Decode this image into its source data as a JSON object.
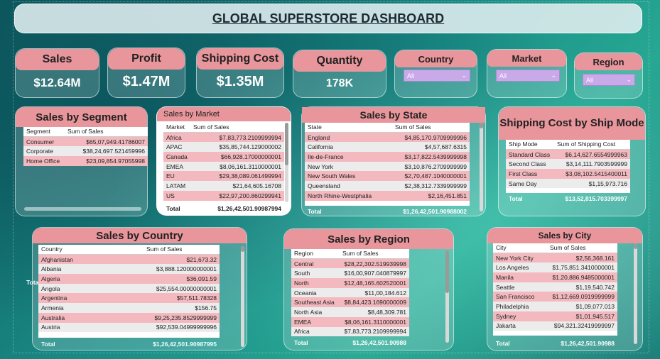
{
  "header": {
    "title": "GLOBAL SUPERSTORE DASHBOARD"
  },
  "kpis": {
    "sales": {
      "label": "Sales",
      "value": "$12.64M"
    },
    "profit": {
      "label": "Profit",
      "value": "$1.47M"
    },
    "shipping": {
      "label": "Shipping Cost",
      "value": "$1.35M"
    },
    "quantity": {
      "label": "Quantity",
      "value": "178K"
    }
  },
  "slicers": {
    "country": {
      "label": "Country",
      "value": "All"
    },
    "market": {
      "label": "Market",
      "value": "All"
    },
    "region": {
      "label": "Region",
      "value": "All"
    }
  },
  "segment": {
    "title": "Sales by Segment",
    "columns": [
      "Segment",
      "Sum of Sales"
    ],
    "rows": [
      [
        "Consumer",
        "$65,07,949.41786007"
      ],
      [
        "Corporate",
        "$38,24,697.521459996"
      ],
      [
        "Home Office",
        "$23,09,854.97055998"
      ]
    ],
    "total": [
      "Total",
      "$1,26,42,501.90988005"
    ]
  },
  "market": {
    "title": "Sales by Market",
    "columns": [
      "Market",
      "Sum of Sales"
    ],
    "rows": [
      [
        "Africa",
        "$7,83,773.2109999994"
      ],
      [
        "APAC",
        "$35,85,744.129000002"
      ],
      [
        "Canada",
        "$66,928.17000000001"
      ],
      [
        "EMEA",
        "$8,06,161.3110000001"
      ],
      [
        "EU",
        "$29,38,089.061499994"
      ],
      [
        "LATAM",
        "$21,64,605.16708"
      ],
      [
        "US",
        "$22,97,200.860299941"
      ]
    ],
    "total": [
      "Total",
      "$1,26,42,501.90987994"
    ]
  },
  "state": {
    "title": "Sales by State",
    "columns": [
      "State",
      "Sum of Sales"
    ],
    "rows": [
      [
        "England",
        "$4,85,170.9709999996"
      ],
      [
        "California",
        "$4,57,687.6315"
      ],
      [
        "Ile-de-France",
        "$3,17,822.5439999998"
      ],
      [
        "New York",
        "$3,10,876.2709999999"
      ],
      [
        "New South Wales",
        "$2,70,487.1040000001"
      ],
      [
        "Queensland",
        "$2,38,312.7339999999"
      ],
      [
        "North Rhine-Westphalia",
        "$2,16,451.851"
      ]
    ],
    "total": [
      "Total",
      "$1,26,42,501.90988002"
    ]
  },
  "shipmode": {
    "title": "Shipping Cost by Ship Mode",
    "columns": [
      "Ship Mode",
      "Sum of Shipping Cost"
    ],
    "rows": [
      [
        "Standard Class",
        "$6,14,627.6554999963"
      ],
      [
        "Second Class",
        "$3,14,111.7903599999"
      ],
      [
        "First Class",
        "$3,08,102.5415400011"
      ],
      [
        "Same Day",
        "$1,15,973.716"
      ]
    ],
    "total": [
      "Total",
      "$13,52,815.703399997"
    ]
  },
  "country": {
    "title": "Sales by Country",
    "columns": [
      "Country",
      "Sum of Sales"
    ],
    "rows": [
      [
        "Afghanistan",
        "$21,673.32"
      ],
      [
        "Albania",
        "$3,888.120000000001"
      ],
      [
        "Algeria",
        "$36,091.59"
      ],
      [
        "Angola",
        "$25,554.00000000001"
      ],
      [
        "Argentina",
        "$57,511.78328"
      ],
      [
        "Armenia",
        "$156.75"
      ],
      [
        "Australia",
        "$9,25,235.8529999999"
      ],
      [
        "Austria",
        "$92,539.04999999996"
      ]
    ],
    "total": [
      "Total",
      "$1,26,42,501.90987995"
    ]
  },
  "region": {
    "title": "Sales by Region",
    "columns": [
      "Region",
      "Sum of Sales"
    ],
    "rows": [
      [
        "Central",
        "$28,22,302.519939998"
      ],
      [
        "South",
        "$16,00,907.040879997"
      ],
      [
        "North",
        "$12,48,165.602520001"
      ],
      [
        "Oceania",
        "$11,00,184.612"
      ],
      [
        "Southeast Asia",
        "$8,84,423.1690000009"
      ],
      [
        "North Asia",
        "$8,48,309.781"
      ],
      [
        "EMEA",
        "$8,06,161.3110000001"
      ],
      [
        "Africa",
        "$7,83,773.2109999994"
      ]
    ],
    "total": [
      "Total",
      "$1,26,42,501.90988"
    ]
  },
  "city": {
    "title": "Sales by City",
    "columns": [
      "City",
      "Sum of Sales"
    ],
    "rows": [
      [
        "New York City",
        "$2,56,368.161"
      ],
      [
        "Los Angeles",
        "$1,75,851.3410000001"
      ],
      [
        "Manila",
        "$1,20,886.9485000001"
      ],
      [
        "Seattle",
        "$1,19,540.742"
      ],
      [
        "San Francisco",
        "$1,12,669.0919999999"
      ],
      [
        "Philadelphia",
        "$1,09,077.013"
      ],
      [
        "Sydney",
        "$1,01,945.517"
      ],
      [
        "Jakarta",
        "$94,321.32419999997"
      ]
    ],
    "total": [
      "Total",
      "$1,26,42,501.90988"
    ]
  },
  "icons": {
    "dropdown": "chevron-down-icon",
    "sort": "sort-desc-icon"
  }
}
